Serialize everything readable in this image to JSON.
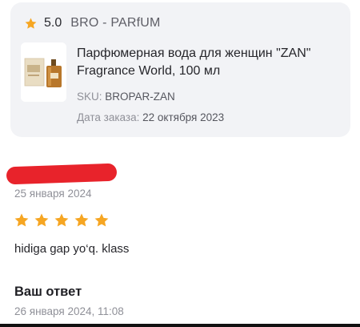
{
  "product_card": {
    "rating": "5.0",
    "seller": "BRO - PARfUM",
    "title": "Парфюмерная вода для женщин \"ZAN\" Fragrance World, 100 мл",
    "sku_label": "SKU:",
    "sku_value": "BROPAR-ZAN",
    "order_label": "Дата заказа:",
    "order_value": "22 октября 2023",
    "thumbnail_icon": "perfume-bottles-image"
  },
  "review": {
    "author": "",
    "date": "25 января 2024",
    "stars": 5,
    "text": "hidiga gap yo‘q. klass"
  },
  "answer": {
    "heading": "Ваш ответ",
    "date": "26 января 2024, 11:08"
  },
  "colors": {
    "star": "#f6a623",
    "card_bg": "#f2f3f6",
    "redaction": "#e8232b"
  }
}
